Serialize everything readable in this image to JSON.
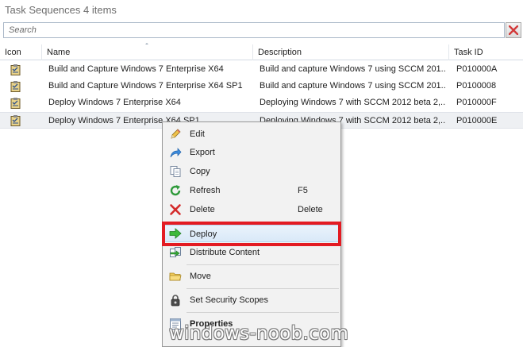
{
  "header": {
    "title": "Task Sequences 4 items"
  },
  "search": {
    "placeholder": "Search"
  },
  "grid": {
    "columns": [
      "Icon",
      "Name",
      "Description",
      "Task ID"
    ],
    "sorted_column": "Name",
    "rows": [
      {
        "name": "Build and Capture Windows 7 Enterprise X64",
        "description": "Build and capture Windows 7 using SCCM 201...",
        "task_id": "P010000A",
        "selected": false
      },
      {
        "name": "Build and Capture Windows 7 Enterprise X64 SP1",
        "description": "Build and capture Windows 7 using SCCM 201...",
        "task_id": "P0100008",
        "selected": false
      },
      {
        "name": "Deploy Windows 7 Enterprise X64",
        "description": "Deploying Windows 7 with SCCM 2012 beta 2,...",
        "task_id": "P010000F",
        "selected": false
      },
      {
        "name": "Deploy Windows 7 Enterprise X64 SP1",
        "description": "Deploying Windows 7 with SCCM 2012 beta 2,...",
        "task_id": "P010000E",
        "selected": true
      }
    ]
  },
  "context_menu": {
    "items": [
      {
        "label": "Edit",
        "shortcut": "",
        "icon": "pencil-icon"
      },
      {
        "label": "Export",
        "shortcut": "",
        "icon": "export-arrow-icon"
      },
      {
        "label": "Copy",
        "shortcut": "",
        "icon": "copy-icon"
      },
      {
        "label": "Refresh",
        "shortcut": "F5",
        "icon": "refresh-icon"
      },
      {
        "label": "Delete",
        "shortcut": "Delete",
        "icon": "delete-x-icon"
      },
      {
        "label": "Deploy",
        "shortcut": "",
        "icon": "deploy-arrow-icon",
        "highlighted": true
      },
      {
        "label": "Distribute Content",
        "shortcut": "",
        "icon": "distribute-content-icon"
      },
      {
        "label": "Move",
        "shortcut": "",
        "icon": "folder-icon"
      },
      {
        "label": "Set Security Scopes",
        "shortcut": "",
        "icon": "lock-icon"
      },
      {
        "label": "Properties",
        "shortcut": "",
        "icon": "properties-icon",
        "bold": true
      }
    ]
  },
  "colors": {
    "highlight_box": "#e31b23",
    "selected_row": "#eef0f3",
    "menu_background": "#f2f2f2",
    "hover_item": "#d9e9f8"
  },
  "watermark": {
    "text": "windows-noob.com"
  }
}
